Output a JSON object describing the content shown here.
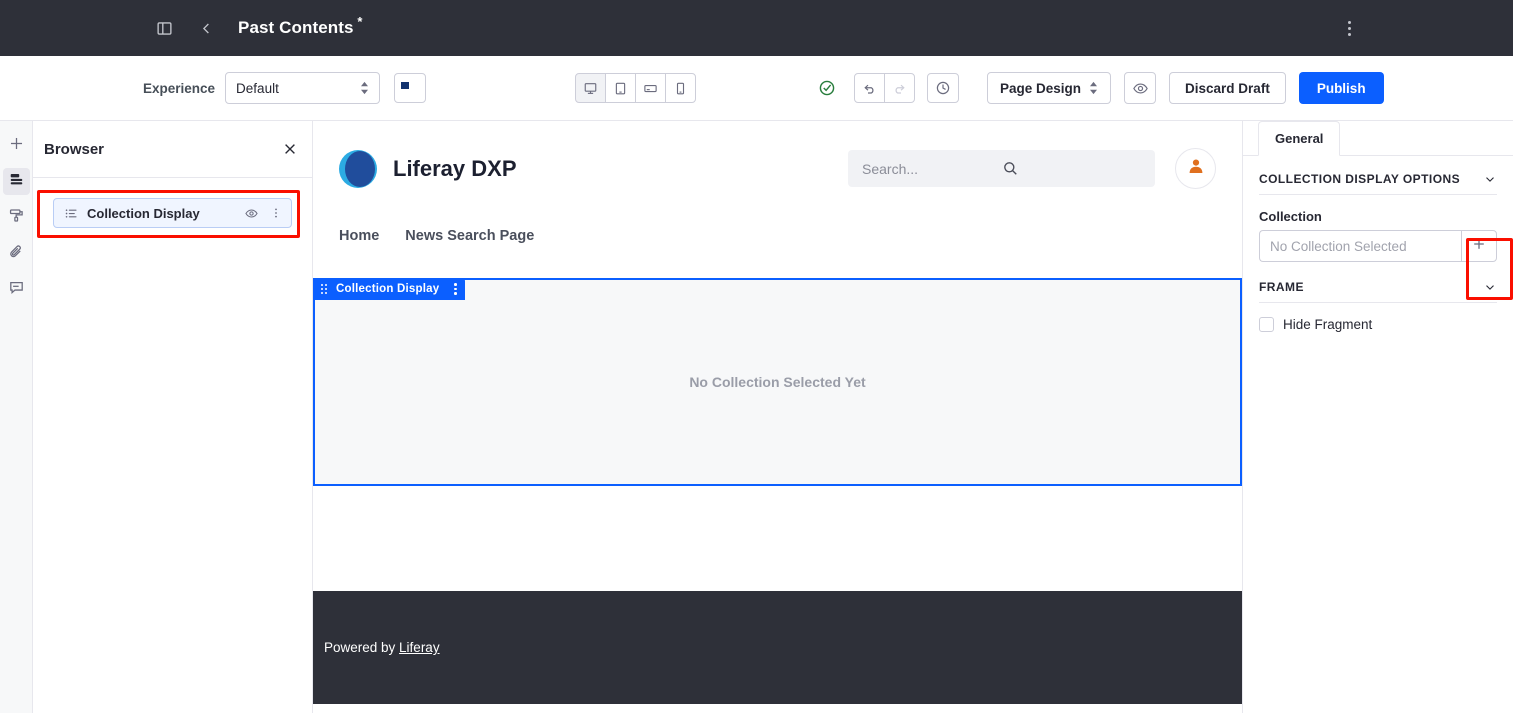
{
  "topbar": {
    "sidebar_toggle_icon": "panel-toggle-icon",
    "back_icon": "chevron-left-icon",
    "title": "Past Contents",
    "modified_marker": "*",
    "kebab_icon": "kebab-vertical-icon"
  },
  "toolbar": {
    "experience_label": "Experience",
    "experience_value": "Default",
    "language_flag": "us-flag-icon",
    "devices": [
      {
        "name": "desktop",
        "icon": "desktop-icon",
        "active": true
      },
      {
        "name": "tablet",
        "icon": "tablet-icon",
        "active": false
      },
      {
        "name": "tablet-landscape",
        "icon": "tablet-landscape-icon",
        "active": false
      },
      {
        "name": "mobile",
        "icon": "mobile-icon",
        "active": false
      }
    ],
    "status_icon": "check-circle-icon",
    "undo_icon": "undo-icon",
    "redo_icon": "redo-icon",
    "history_icon": "clock-icon",
    "page_design_label": "Page Design",
    "preview_icon": "eye-icon",
    "discard_label": "Discard Draft",
    "publish_label": "Publish",
    "accent_color": "#0b5fff"
  },
  "rail": {
    "items": [
      {
        "name": "add-icon",
        "label": "Add"
      },
      {
        "name": "browser-icon",
        "label": "Browser",
        "active": true
      },
      {
        "name": "paint-roller-icon",
        "label": "Page Design Options"
      },
      {
        "name": "paperclip-icon",
        "label": "Contents"
      },
      {
        "name": "comment-icon",
        "label": "Comments"
      }
    ]
  },
  "browser": {
    "title": "Browser",
    "close_icon": "close-icon",
    "items": [
      {
        "label": "Collection Display",
        "icon": "list-ul-icon",
        "visibility_icon": "eye-icon",
        "options_icon": "kebab-vertical-icon"
      }
    ],
    "highlight_color": "#fa0f00"
  },
  "canvas": {
    "site_name": "Liferay DXP",
    "logo_icon": "liferay-logo-icon",
    "search_placeholder": "Search...",
    "search_icon": "search-icon",
    "avatar_icon": "user-avatar-icon",
    "nav": [
      {
        "label": "Home"
      },
      {
        "label": "News Search Page"
      }
    ],
    "fragment": {
      "bar_label": "Collection Display",
      "drag_icon": "drag-handle-icon",
      "options_icon": "kebab-vertical-icon",
      "empty_message": "No Collection Selected Yet",
      "selection_color": "#0b5fff"
    },
    "footer": {
      "prefix": "Powered by ",
      "link": "Liferay"
    }
  },
  "right_panel": {
    "tabs": [
      {
        "label": "General",
        "active": true
      }
    ],
    "sections": [
      {
        "title": "COLLECTION DISPLAY OPTIONS",
        "chevron_icon": "chevron-down-icon",
        "field_label": "Collection",
        "field_value": "No Collection Selected",
        "add_icon": "plus-icon"
      },
      {
        "title": "FRAME",
        "chevron_icon": "chevron-down-icon",
        "checkbox_label": "Hide Fragment",
        "checkbox_checked": false
      }
    ],
    "highlight_color": "#fa0f00"
  }
}
